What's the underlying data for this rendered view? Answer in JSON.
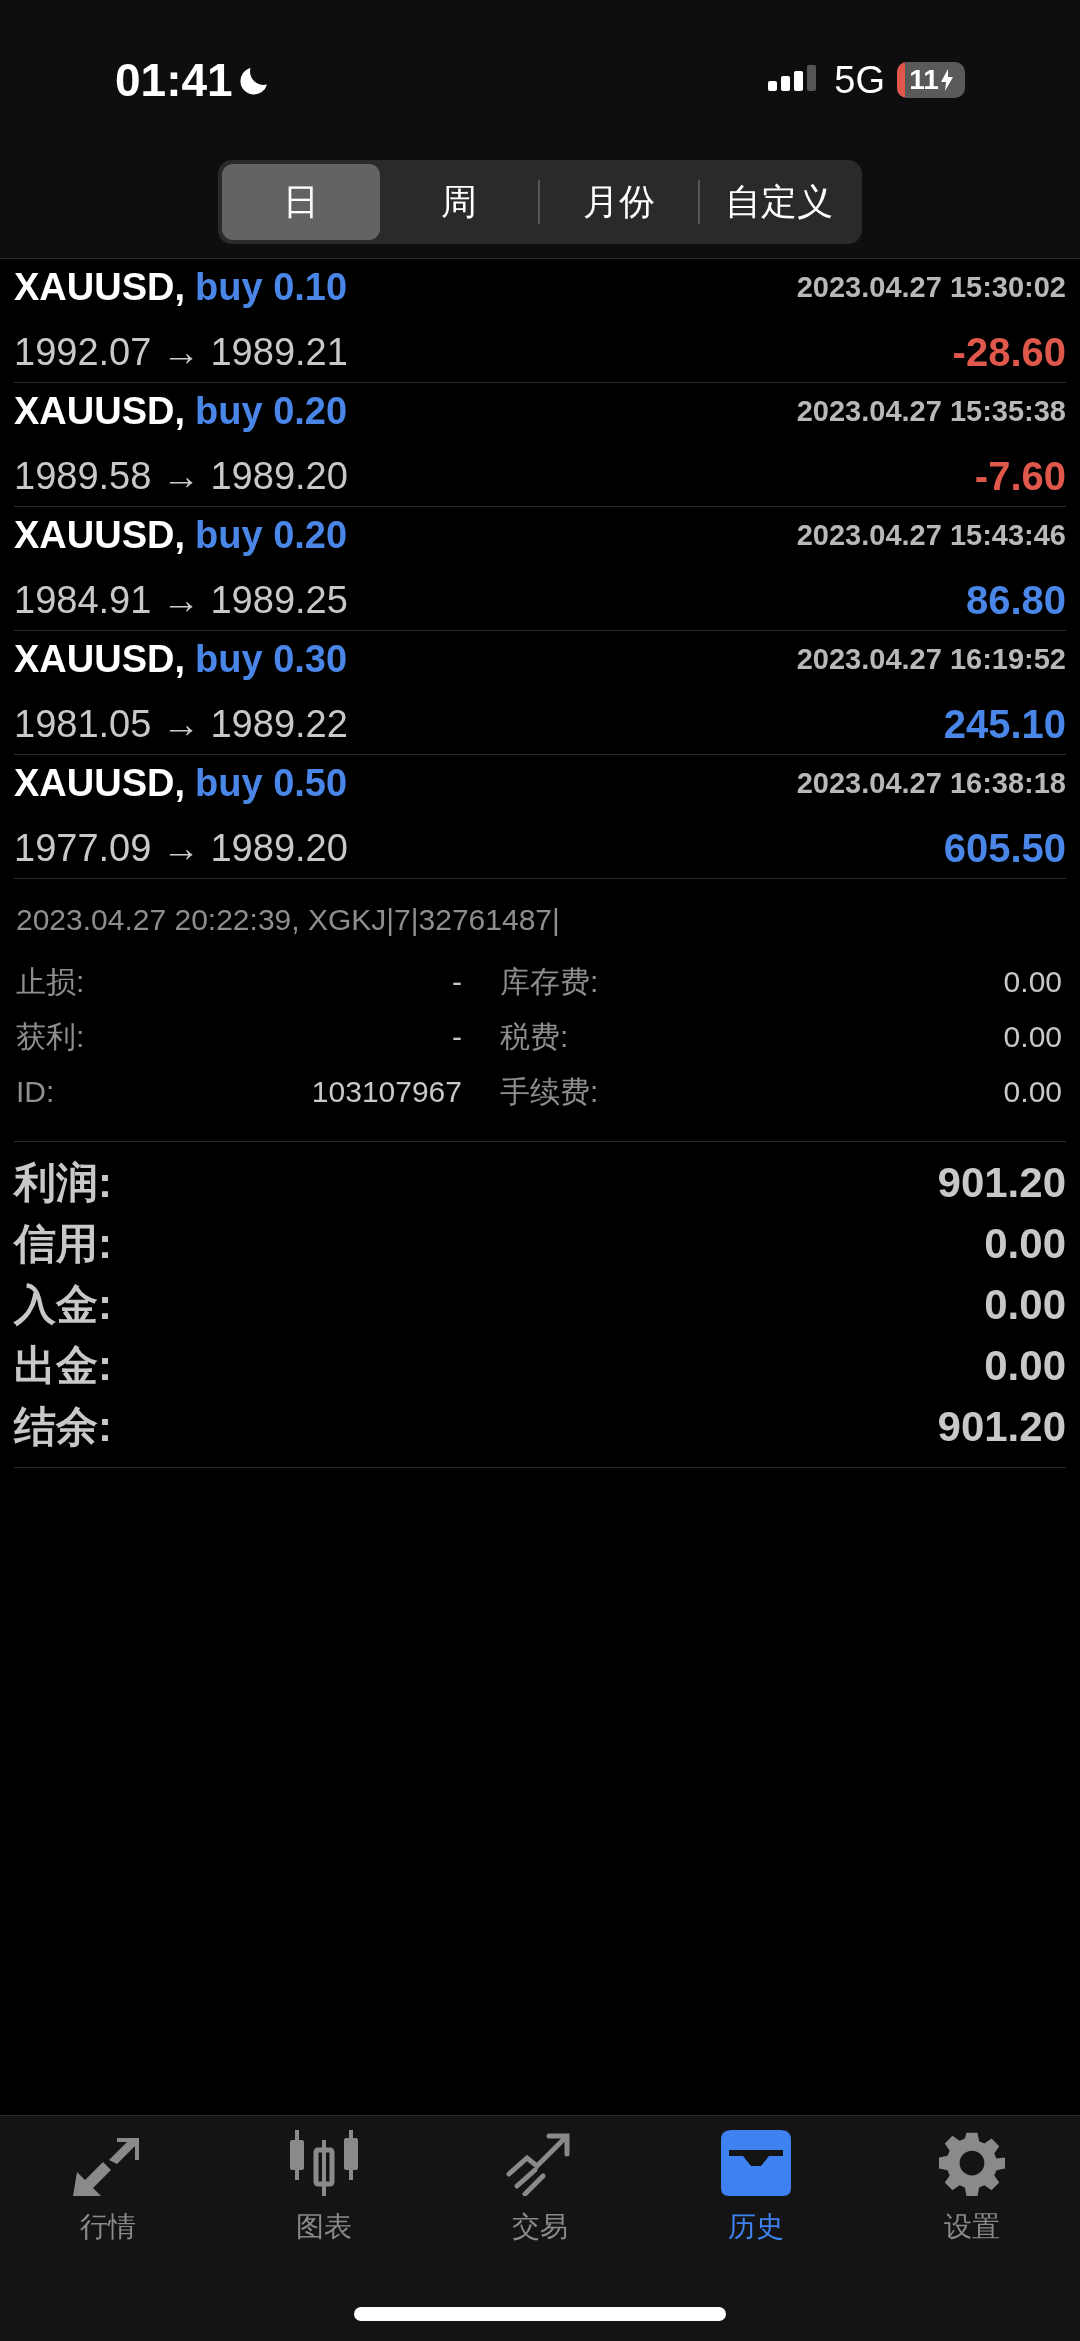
{
  "status_bar": {
    "time": "01:41",
    "network": "5G",
    "battery": "11"
  },
  "period_tabs": [
    {
      "label": "日",
      "selected": true
    },
    {
      "label": "周",
      "selected": false
    },
    {
      "label": "月份",
      "selected": false
    },
    {
      "label": "自定义",
      "selected": false
    }
  ],
  "trades": [
    {
      "symbol": "XAUUSD,",
      "side": "buy 0.10",
      "time": "2023.04.27 15:30:02",
      "prices": "1992.07 → 1989.21",
      "profit": "-28.60",
      "color": "#e0574c"
    },
    {
      "symbol": "XAUUSD,",
      "side": "buy 0.20",
      "time": "2023.04.27 15:35:38",
      "prices": "1989.58 → 1989.20",
      "profit": "-7.60",
      "color": "#e0574c"
    },
    {
      "symbol": "XAUUSD,",
      "side": "buy 0.20",
      "time": "2023.04.27 15:43:46",
      "prices": "1984.91 → 1989.25",
      "profit": "86.80",
      "color": "#4a86e8"
    },
    {
      "symbol": "XAUUSD,",
      "side": "buy 0.30",
      "time": "2023.04.27 16:19:52",
      "prices": "1981.05 → 1989.22",
      "profit": "245.10",
      "color": "#4a86e8"
    },
    {
      "symbol": "XAUUSD,",
      "side": "buy 0.50",
      "time": "2023.04.27 16:38:18",
      "prices": "1977.09 → 1989.20",
      "profit": "605.50",
      "color": "#4a86e8"
    }
  ],
  "details": {
    "header": "2023.04.27 20:22:39, XGKJ|7|32761487|",
    "rows": [
      {
        "left_label": "止损:",
        "left_value": "-",
        "right_label": "库存费:",
        "right_value": "0.00"
      },
      {
        "left_label": "获利:",
        "left_value": "-",
        "right_label": "税费:",
        "right_value": "0.00"
      },
      {
        "left_label": "ID:",
        "left_value": "103107967",
        "right_label": "手续费:",
        "right_value": "0.00"
      }
    ]
  },
  "summary": [
    {
      "label": "利润:",
      "value": "901.20"
    },
    {
      "label": "信用:",
      "value": "0.00"
    },
    {
      "label": "入金:",
      "value": "0.00"
    },
    {
      "label": "出金:",
      "value": "0.00"
    },
    {
      "label": "结余:",
      "value": "901.20"
    }
  ],
  "bottom_tabs": [
    {
      "label": "行情",
      "kind": "quotes",
      "selected": false
    },
    {
      "label": "图表",
      "kind": "chart",
      "selected": false
    },
    {
      "label": "交易",
      "kind": "trade",
      "selected": false
    },
    {
      "label": "历史",
      "kind": "history",
      "selected": true
    },
    {
      "label": "设置",
      "kind": "settings",
      "selected": false
    }
  ]
}
